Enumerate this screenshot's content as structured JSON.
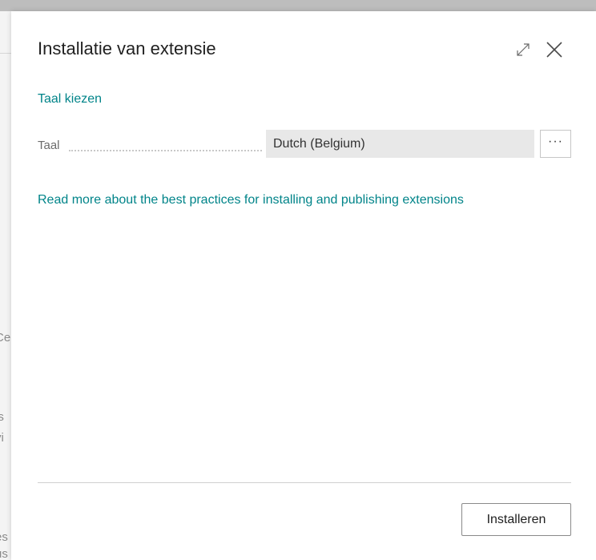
{
  "background": {
    "fragments": [
      "Ce",
      "is",
      "vi",
      "es",
      "us"
    ]
  },
  "dialog": {
    "title": "Installatie van extensie",
    "section_link": "Taal kiezen",
    "field": {
      "label": "Taal",
      "value": "Dutch (Belgium)",
      "lookup_label": "···"
    },
    "info_link": "Read more about the best practices for installing and publishing extensions",
    "install_button": "Installeren",
    "icons": {
      "expand": "expand-icon",
      "close": "close-icon"
    }
  },
  "colors": {
    "accent_link": "#008489",
    "field_background": "#e8e8e8"
  }
}
